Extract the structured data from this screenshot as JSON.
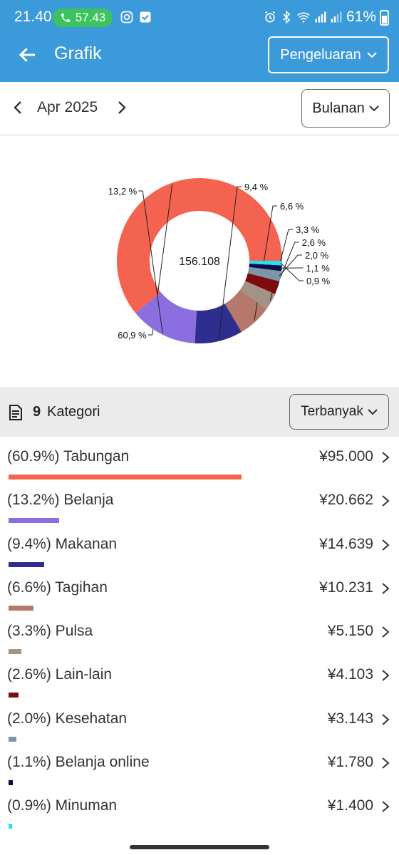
{
  "status": {
    "time": "21.40",
    "call_timer": "57.43",
    "battery": "61%"
  },
  "appbar": {
    "title": "Grafik",
    "type_select": "Pengeluaran"
  },
  "period": {
    "month": "Apr 2025",
    "range_select": "Bulanan"
  },
  "chart_data": {
    "type": "pie",
    "center_label": "156.108",
    "slices": [
      {
        "label": "60,9 %",
        "value": 60.9,
        "color": "#f4634f"
      },
      {
        "label": "13,2 %",
        "value": 13.2,
        "color": "#8b6fe0"
      },
      {
        "label": "9,4 %",
        "value": 9.4,
        "color": "#2e2e8e"
      },
      {
        "label": "6,6 %",
        "value": 6.6,
        "color": "#b5786a"
      },
      {
        "label": "3,3 %",
        "value": 3.3,
        "color": "#a29386"
      },
      {
        "label": "2,6 %",
        "value": 2.6,
        "color": "#7f0c0c"
      },
      {
        "label": "2,0 %",
        "value": 2.0,
        "color": "#7d96a8"
      },
      {
        "label": "1,1 %",
        "value": 1.1,
        "color": "#0b0b4e"
      },
      {
        "label": "0,9 %",
        "value": 0.9,
        "color": "#25e0ee"
      }
    ]
  },
  "categories": {
    "count": "9",
    "label": "Kategori",
    "sort_select": "Terbanyak",
    "items": [
      {
        "name": "(60.9%) Tabungan",
        "amount": "¥95.000",
        "percent": 60.9,
        "color": "#f4634f"
      },
      {
        "name": "(13.2%) Belanja",
        "amount": "¥20.662",
        "percent": 13.2,
        "color": "#8b6fe0"
      },
      {
        "name": "(9.4%) Makanan",
        "amount": "¥14.639",
        "percent": 9.4,
        "color": "#2e2e8e"
      },
      {
        "name": "(6.6%) Tagihan",
        "amount": "¥10.231",
        "percent": 6.6,
        "color": "#b5786a"
      },
      {
        "name": "(3.3%) Pulsa",
        "amount": "¥5.150",
        "percent": 3.3,
        "color": "#a29386"
      },
      {
        "name": "(2.6%) Lain-lain",
        "amount": "¥4.103",
        "percent": 2.6,
        "color": "#7f0c0c"
      },
      {
        "name": "(2.0%) Kesehatan",
        "amount": "¥3.143",
        "percent": 2.0,
        "color": "#7d96a8"
      },
      {
        "name": "(1.1%) Belanja online",
        "amount": "¥1.780",
        "percent": 1.1,
        "color": "#0b0b4e"
      },
      {
        "name": "(0.9%) Minuman",
        "amount": "¥1.400",
        "percent": 0.9,
        "color": "#25e0ee"
      }
    ]
  }
}
